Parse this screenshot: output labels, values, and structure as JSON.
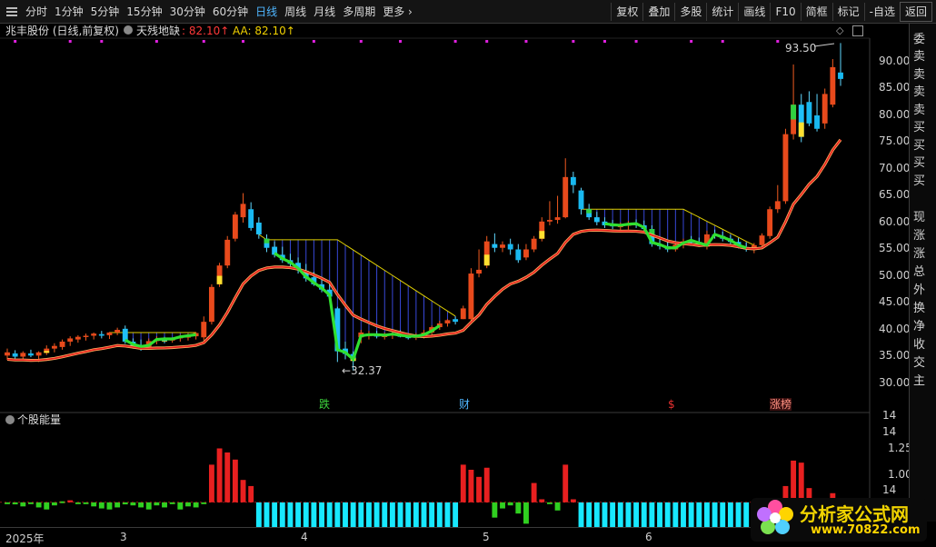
{
  "toolbar": {
    "periods": [
      "分时",
      "1分钟",
      "5分钟",
      "15分钟",
      "30分钟",
      "60分钟",
      "日线",
      "周线",
      "月线",
      "多周期",
      "更多 ›"
    ],
    "active_period": "日线",
    "right_buttons": [
      "复权",
      "叠加",
      "多股",
      "统计",
      "画线",
      "F10",
      "简框",
      "标记",
      "-自选",
      "返回"
    ]
  },
  "info": {
    "stock_name": "兆丰股份 (日线,前复权)",
    "indicator_name": "天残地缺",
    "indicator_value": ": 82.10↑",
    "aa_label": "AA: 82.10↑"
  },
  "price_axis": [
    "90.00",
    "85.00",
    "80.00",
    "75.00",
    "70.00",
    "65.00",
    "60.00",
    "55.00",
    "50.00",
    "45.00",
    "40.00",
    "35.00",
    "30.00"
  ],
  "annotations": {
    "high": "93.50",
    "low": "←32.37"
  },
  "event_tags": [
    {
      "text": "跌",
      "color": "#3cd23c"
    },
    {
      "text": "财",
      "color": "#4fb6ff"
    },
    {
      "text": "$",
      "color": "#e83030"
    },
    {
      "text": "涨榜",
      "color": "#ff9080"
    }
  ],
  "sidebar": [
    "委",
    "卖",
    "卖",
    "卖",
    "卖",
    "买",
    "买",
    "买",
    "买",
    "现",
    "涨",
    "涨",
    "总",
    "外",
    "换",
    "净",
    "收",
    "交",
    "主"
  ],
  "volume": {
    "title": "个股能量",
    "axis_labels": [
      "14",
      "14",
      "1.25",
      "1.00",
      "14",
      "14"
    ]
  },
  "xaxis": [
    "2025年",
    "3",
    "4",
    "5",
    "6"
  ],
  "watermark": {
    "title": "分析家公式网",
    "url": "www.70822.com"
  },
  "chart_data": {
    "type": "candlestick",
    "ylim": [
      27,
      95
    ],
    "ohlc": [
      [
        35.2,
        36.5,
        34.4,
        35.8
      ],
      [
        35.6,
        36.2,
        34.6,
        35.0
      ],
      [
        35.0,
        36.0,
        34.3,
        35.7
      ],
      [
        35.6,
        36.3,
        34.9,
        35.2
      ],
      [
        35.2,
        36.0,
        34.0,
        35.8
      ],
      [
        35.7,
        37.1,
        35.3,
        36.5
      ],
      [
        36.5,
        37.5,
        35.8,
        37.0
      ],
      [
        36.8,
        38.2,
        36.3,
        37.8
      ],
      [
        37.8,
        38.8,
        37.0,
        38.4
      ],
      [
        38.2,
        39.0,
        37.6,
        38.7
      ],
      [
        38.7,
        39.3,
        38.0,
        38.9
      ],
      [
        38.9,
        39.5,
        38.2,
        39.3
      ],
      [
        39.2,
        39.8,
        38.4,
        38.9
      ],
      [
        39.0,
        39.6,
        38.3,
        39.5
      ],
      [
        39.5,
        40.4,
        39.0,
        40.0
      ],
      [
        40.2,
        40.8,
        37.4,
        37.8
      ],
      [
        37.8,
        38.4,
        36.5,
        37.0
      ],
      [
        37.2,
        38.2,
        36.1,
        36.6
      ],
      [
        36.8,
        38.4,
        36.5,
        37.9
      ],
      [
        37.9,
        38.8,
        37.3,
        38.2
      ],
      [
        38.1,
        38.7,
        37.5,
        38.0
      ],
      [
        38.0,
        38.6,
        37.6,
        38.4
      ],
      [
        38.4,
        39.1,
        37.8,
        38.7
      ],
      [
        38.6,
        39.3,
        38.0,
        38.8
      ],
      [
        38.8,
        39.6,
        38.2,
        39.4
      ],
      [
        38.6,
        42.5,
        38.0,
        41.5
      ],
      [
        41.5,
        48.5,
        41.0,
        48.0
      ],
      [
        48.5,
        52.5,
        48.0,
        52.0
      ],
      [
        52.0,
        57.5,
        51.5,
        56.8
      ],
      [
        57.0,
        62.0,
        56.5,
        61.5
      ],
      [
        61.0,
        65.5,
        60.0,
        63.5
      ],
      [
        62.5,
        63.8,
        58.5,
        59.0
      ],
      [
        60.0,
        61.0,
        57.0,
        57.8
      ],
      [
        57.0,
        57.8,
        54.5,
        55.3
      ],
      [
        55.5,
        56.5,
        53.5,
        54.0
      ],
      [
        54.0,
        55.5,
        52.5,
        53.0
      ],
      [
        53.0,
        54.2,
        51.5,
        52.3
      ],
      [
        52.5,
        53.5,
        50.5,
        51.2
      ],
      [
        51.0,
        52.3,
        49.0,
        49.6
      ],
      [
        49.8,
        50.8,
        48.2,
        48.5
      ],
      [
        48.5,
        49.5,
        47.0,
        47.5
      ],
      [
        47.5,
        48.6,
        46.0,
        46.2
      ],
      [
        44.0,
        44.3,
        34.0,
        36.0
      ],
      [
        36.5,
        37.8,
        34.5,
        35.5
      ],
      [
        35.5,
        36.0,
        32.4,
        34.2
      ],
      [
        38.6,
        40.0,
        37.5,
        39.5
      ],
      [
        38.8,
        39.8,
        38.2,
        39.3
      ],
      [
        39.0,
        39.8,
        38.4,
        38.8
      ],
      [
        38.7,
        39.5,
        38.2,
        38.9
      ],
      [
        38.9,
        39.6,
        38.3,
        39.2
      ],
      [
        39.2,
        39.9,
        38.6,
        38.7
      ],
      [
        38.7,
        39.3,
        38.2,
        38.5
      ],
      [
        38.5,
        39.4,
        38.1,
        38.8
      ],
      [
        38.8,
        40.0,
        38.4,
        39.5
      ],
      [
        39.5,
        40.8,
        39.0,
        40.5
      ],
      [
        40.5,
        41.7,
        40.0,
        41.2
      ],
      [
        41.2,
        42.0,
        40.6,
        41.8
      ],
      [
        42.0,
        42.5,
        41.0,
        41.5
      ],
      [
        42.0,
        44.5,
        42.0,
        44.0
      ],
      [
        42.0,
        51.5,
        41.5,
        50.5
      ],
      [
        50.5,
        55.0,
        49.8,
        51.2
      ],
      [
        52.0,
        57.5,
        51.5,
        56.5
      ],
      [
        56.0,
        58.0,
        54.5,
        55.3
      ],
      [
        55.3,
        56.5,
        54.5,
        55.9
      ],
      [
        56.0,
        57.0,
        54.0,
        55.0
      ],
      [
        55.0,
        56.0,
        52.5,
        53.0
      ],
      [
        53.5,
        56.0,
        53.0,
        55.0
      ],
      [
        55.0,
        57.5,
        54.5,
        57.0
      ],
      [
        57.0,
        61.0,
        56.5,
        60.2
      ],
      [
        60.2,
        64.0,
        59.5,
        60.5
      ],
      [
        60.5,
        65.0,
        59.8,
        61.0
      ],
      [
        61.0,
        72.0,
        60.8,
        68.5
      ],
      [
        68.5,
        69.5,
        65.5,
        67.0
      ],
      [
        66.0,
        66.5,
        61.5,
        62.5
      ],
      [
        62.5,
        63.5,
        60.5,
        61.0
      ],
      [
        61.0,
        62.0,
        59.5,
        60.1
      ],
      [
        60.2,
        61.0,
        59.0,
        59.5
      ],
      [
        59.6,
        60.5,
        58.8,
        59.3
      ],
      [
        59.2,
        60.0,
        58.5,
        59.4
      ],
      [
        59.4,
        60.3,
        58.7,
        59.8
      ],
      [
        59.8,
        60.6,
        59.0,
        59.5
      ],
      [
        59.5,
        60.4,
        58.5,
        58.8
      ],
      [
        58.8,
        59.5,
        55.5,
        56.0
      ],
      [
        56.0,
        57.0,
        55.0,
        55.6
      ],
      [
        55.6,
        56.8,
        54.5,
        55.0
      ],
      [
        55.0,
        56.3,
        54.6,
        55.9
      ],
      [
        55.9,
        57.0,
        55.2,
        56.5
      ],
      [
        56.5,
        57.5,
        55.8,
        56.4
      ],
      [
        56.4,
        57.2,
        55.5,
        55.9
      ],
      [
        55.5,
        58.5,
        55.0,
        57.8
      ],
      [
        57.8,
        58.7,
        57.0,
        57.5
      ],
      [
        57.5,
        58.3,
        56.5,
        57.0
      ],
      [
        57.0,
        57.7,
        56.0,
        56.4
      ],
      [
        56.4,
        57.1,
        55.2,
        55.5
      ],
      [
        55.4,
        56.3,
        54.6,
        55.0
      ],
      [
        55.0,
        56.2,
        54.3,
        55.8
      ],
      [
        55.8,
        58.0,
        55.5,
        57.6
      ],
      [
        57.5,
        63.0,
        57.0,
        62.5
      ],
      [
        62.5,
        67.0,
        61.8,
        64.0
      ],
      [
        64.0,
        77.5,
        63.5,
        76.5
      ],
      [
        76.5,
        89.5,
        75.5,
        82.0
      ],
      [
        82.0,
        84.0,
        75.0,
        76.0
      ],
      [
        82.5,
        84.5,
        78.0,
        78.5
      ],
      [
        80.0,
        84.0,
        77.0,
        77.5
      ],
      [
        78.5,
        85.0,
        77.5,
        84.0
      ],
      [
        82.0,
        90.5,
        81.5,
        89.0
      ],
      [
        88.0,
        93.5,
        85.5,
        86.8
      ]
    ],
    "volume_value": [
      0.93,
      0.91,
      0.89,
      0.92,
      0.88,
      0.86,
      0.9,
      0.94,
      0.95,
      0.93,
      0.92,
      0.89,
      0.87,
      0.86,
      0.88,
      0.91,
      0.9,
      0.88,
      0.86,
      0.9,
      0.88,
      0.92,
      0.86,
      0.89,
      0.88,
      0.92,
      1.3,
      1.46,
      1.42,
      1.35,
      1.15,
      1.09,
      0.68,
      0.68,
      0.68,
      0.68,
      0.68,
      0.68,
      0.68,
      0.68,
      0.68,
      0.68,
      0.68,
      0.68,
      0.68,
      0.68,
      0.68,
      0.68,
      0.68,
      0.68,
      0.68,
      0.68,
      0.68,
      0.68,
      0.68,
      0.68,
      0.68,
      0.68,
      1.3,
      1.25,
      1.18,
      1.27,
      0.78,
      0.87,
      0.9,
      0.82,
      0.72,
      1.12,
      0.96,
      0.92,
      0.85,
      1.3,
      0.96,
      0.68,
      0.68,
      0.68,
      0.68,
      0.68,
      0.68,
      0.68,
      0.68,
      0.68,
      0.68,
      0.68,
      0.68,
      0.68,
      0.68,
      0.68,
      0.68,
      0.68,
      0.68,
      0.68,
      0.68,
      0.68,
      0.68,
      0.68,
      0.68,
      0.82,
      0.95,
      1.09,
      1.34,
      1.32,
      1.07,
      0.9,
      0.8,
      1.02,
      0.76,
      0.8
    ]
  }
}
